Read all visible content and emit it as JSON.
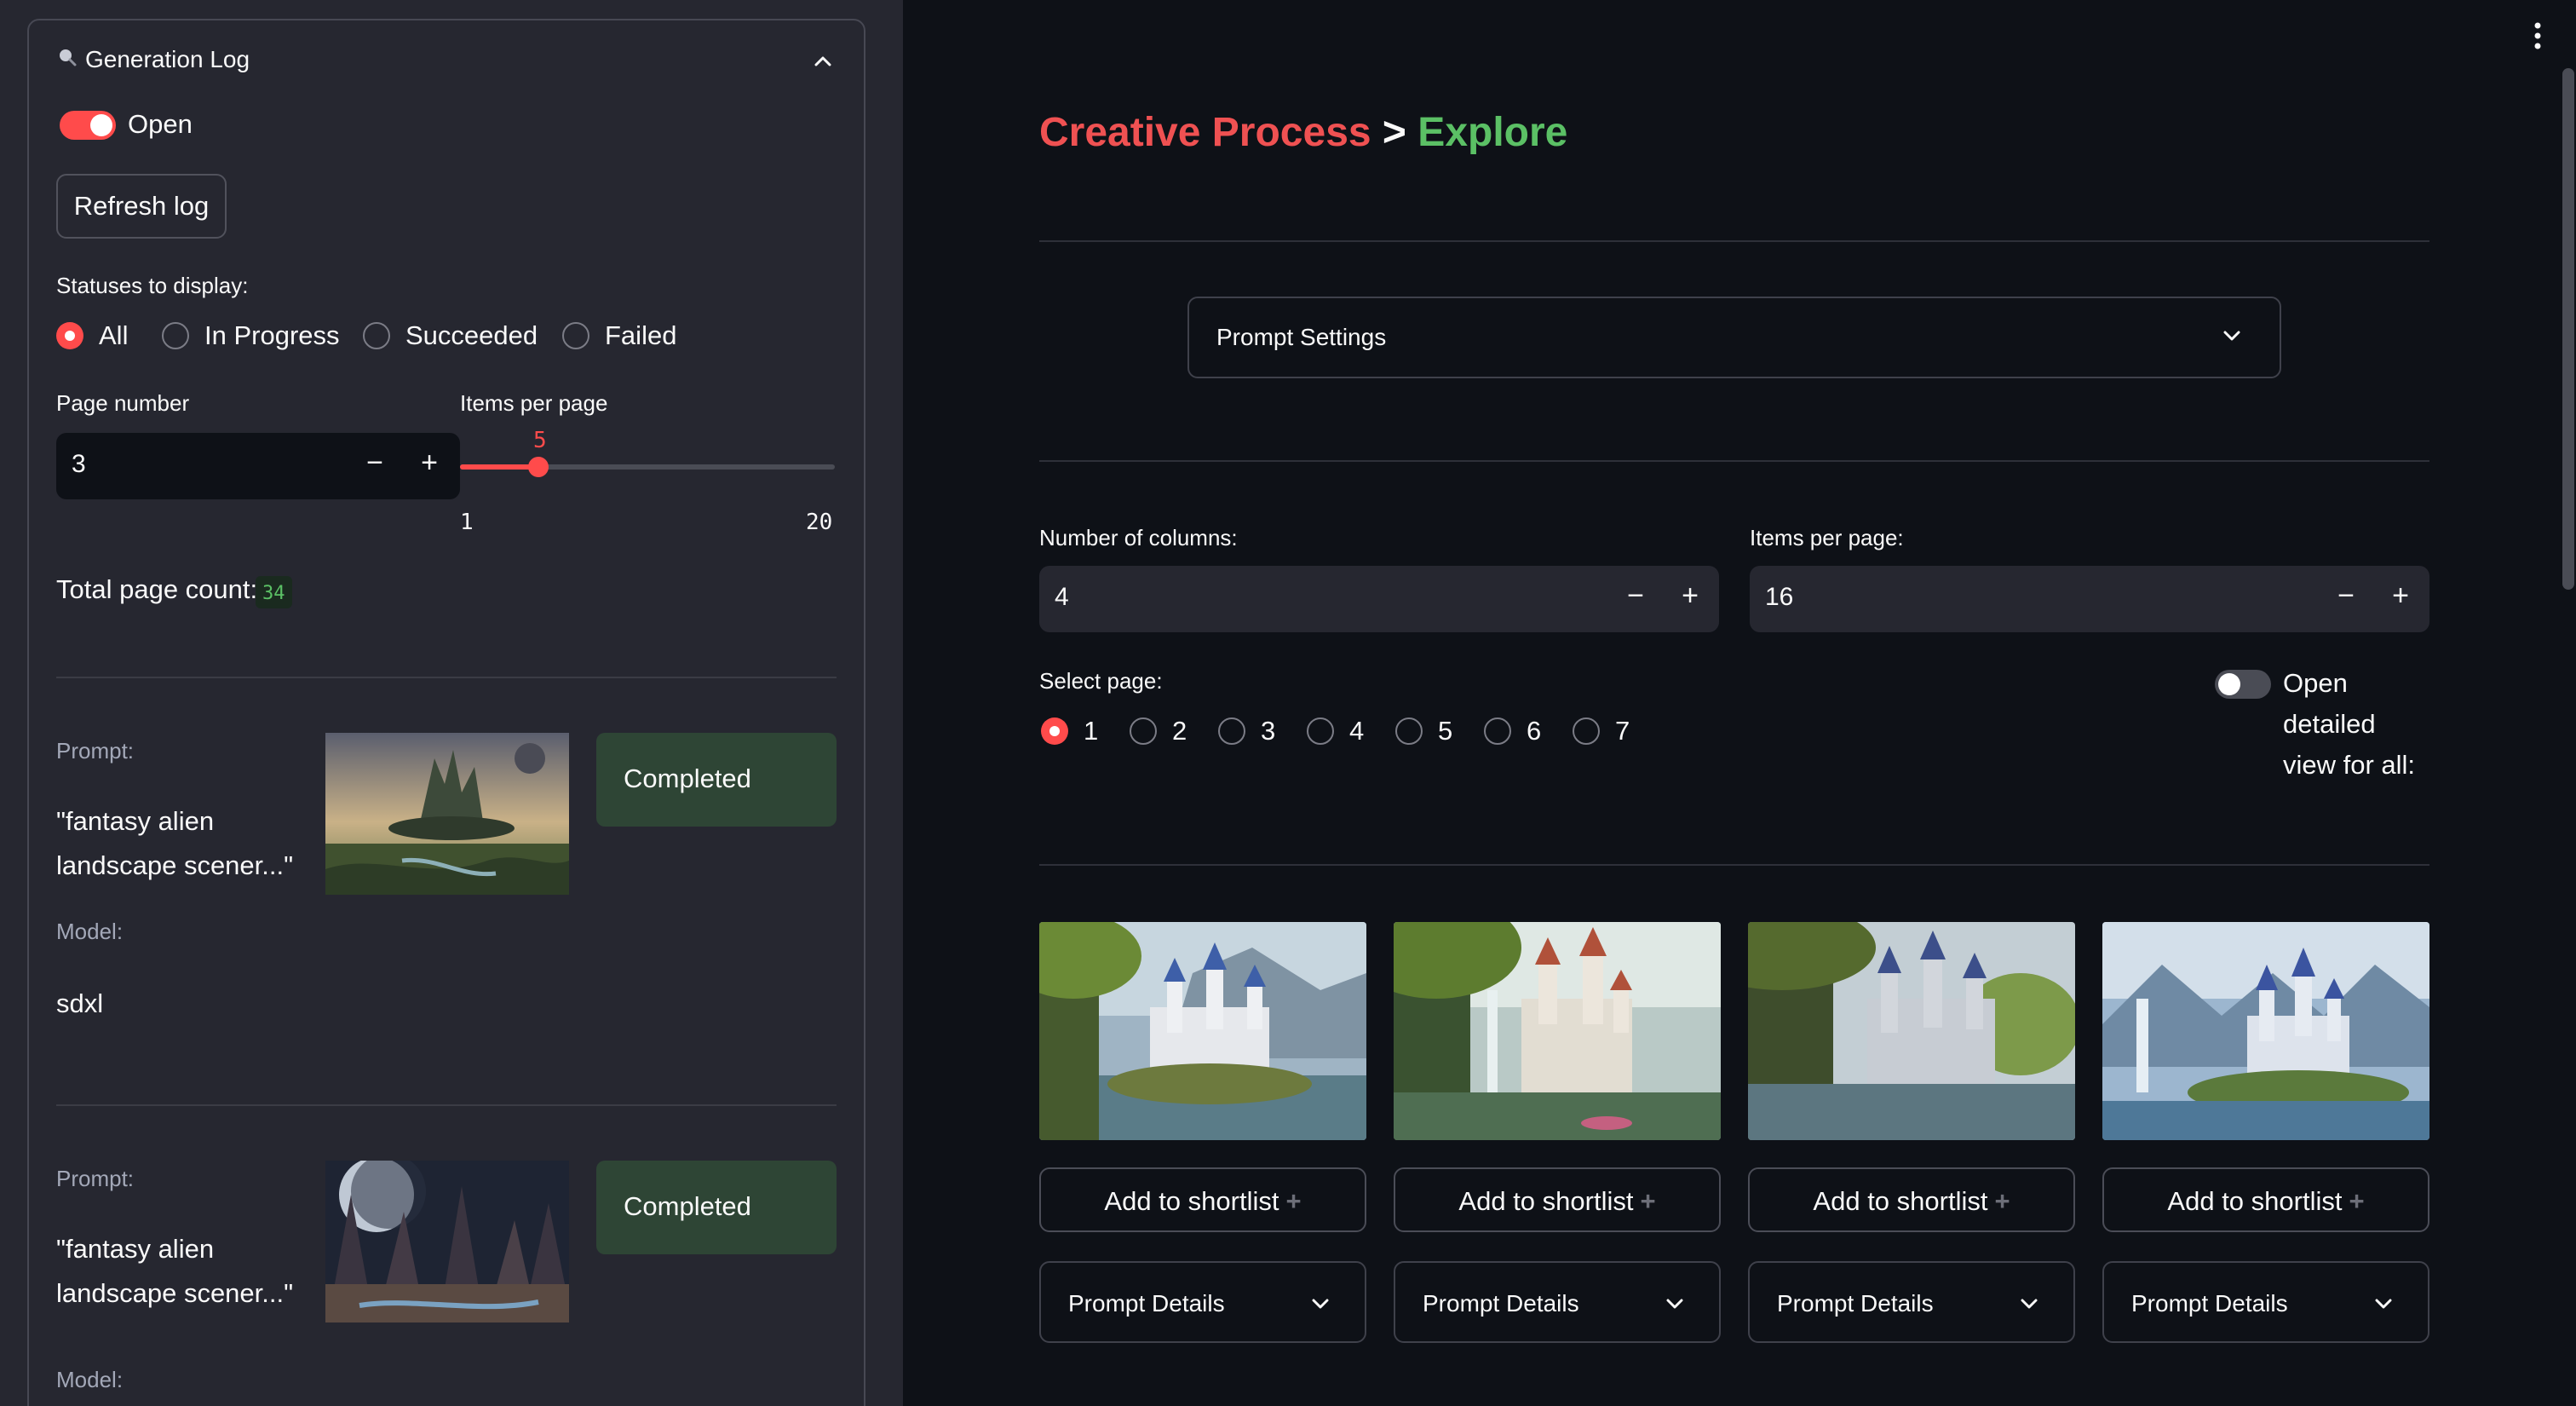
{
  "sidebar": {
    "expander_title": "Generation Log",
    "toggle_label": "Open",
    "refresh_button": "Refresh log",
    "status_label": "Statuses to display:",
    "status_options": [
      "All",
      "In Progress",
      "Succeeded",
      "Failed"
    ],
    "status_selected": "All",
    "page_number_label": "Page number",
    "page_number_value": "3",
    "items_per_page_label": "Items per page",
    "slider": {
      "value": "5",
      "min": "1",
      "max": "20"
    },
    "total_page_count_label": "Total page count:",
    "total_page_count_value": "34",
    "log_items": [
      {
        "prompt_label": "Prompt:",
        "prompt_line1": "\"fantasy alien",
        "prompt_line2": "landscape scener...\"",
        "status": "Completed",
        "model_label": "Model:",
        "model": "sdxl"
      },
      {
        "prompt_label": "Prompt:",
        "prompt_line1": "\"fantasy alien",
        "prompt_line2": "landscape scener...\"",
        "status": "Completed",
        "model_label": "Model:"
      }
    ]
  },
  "main": {
    "title_part1": "Creative Process",
    "title_sep": ">",
    "title_part2": "Explore",
    "prompt_settings": "Prompt Settings",
    "columns_label": "Number of columns:",
    "columns_value": "4",
    "items_per_page_label": "Items per page:",
    "items_per_page_value": "16",
    "select_page_label": "Select page:",
    "pages": [
      "1",
      "2",
      "3",
      "4",
      "5",
      "6",
      "7"
    ],
    "page_selected": "1",
    "detail_toggle_lines": [
      "Open",
      "detailed",
      "view for all:"
    ],
    "cards": [
      {
        "shortlist": "Add to shortlist",
        "details": "Prompt Details"
      },
      {
        "shortlist": "Add to shortlist",
        "details": "Prompt Details"
      },
      {
        "shortlist": "Add to shortlist",
        "details": "Prompt Details"
      },
      {
        "shortlist": "Add to shortlist",
        "details": "Prompt Details"
      }
    ]
  },
  "colors": {
    "accent": "#ff4b4b",
    "title_red": "#ef5152",
    "title_green": "#5bc065",
    "success_bg": "#2e4535",
    "sidebar_bg": "#262730",
    "main_bg": "#0e1117"
  },
  "icons": [
    "magnifier-icon",
    "chevron-up-icon",
    "chevron-down-icon",
    "plus-icon",
    "minus-icon",
    "kebab-menu-icon"
  ]
}
